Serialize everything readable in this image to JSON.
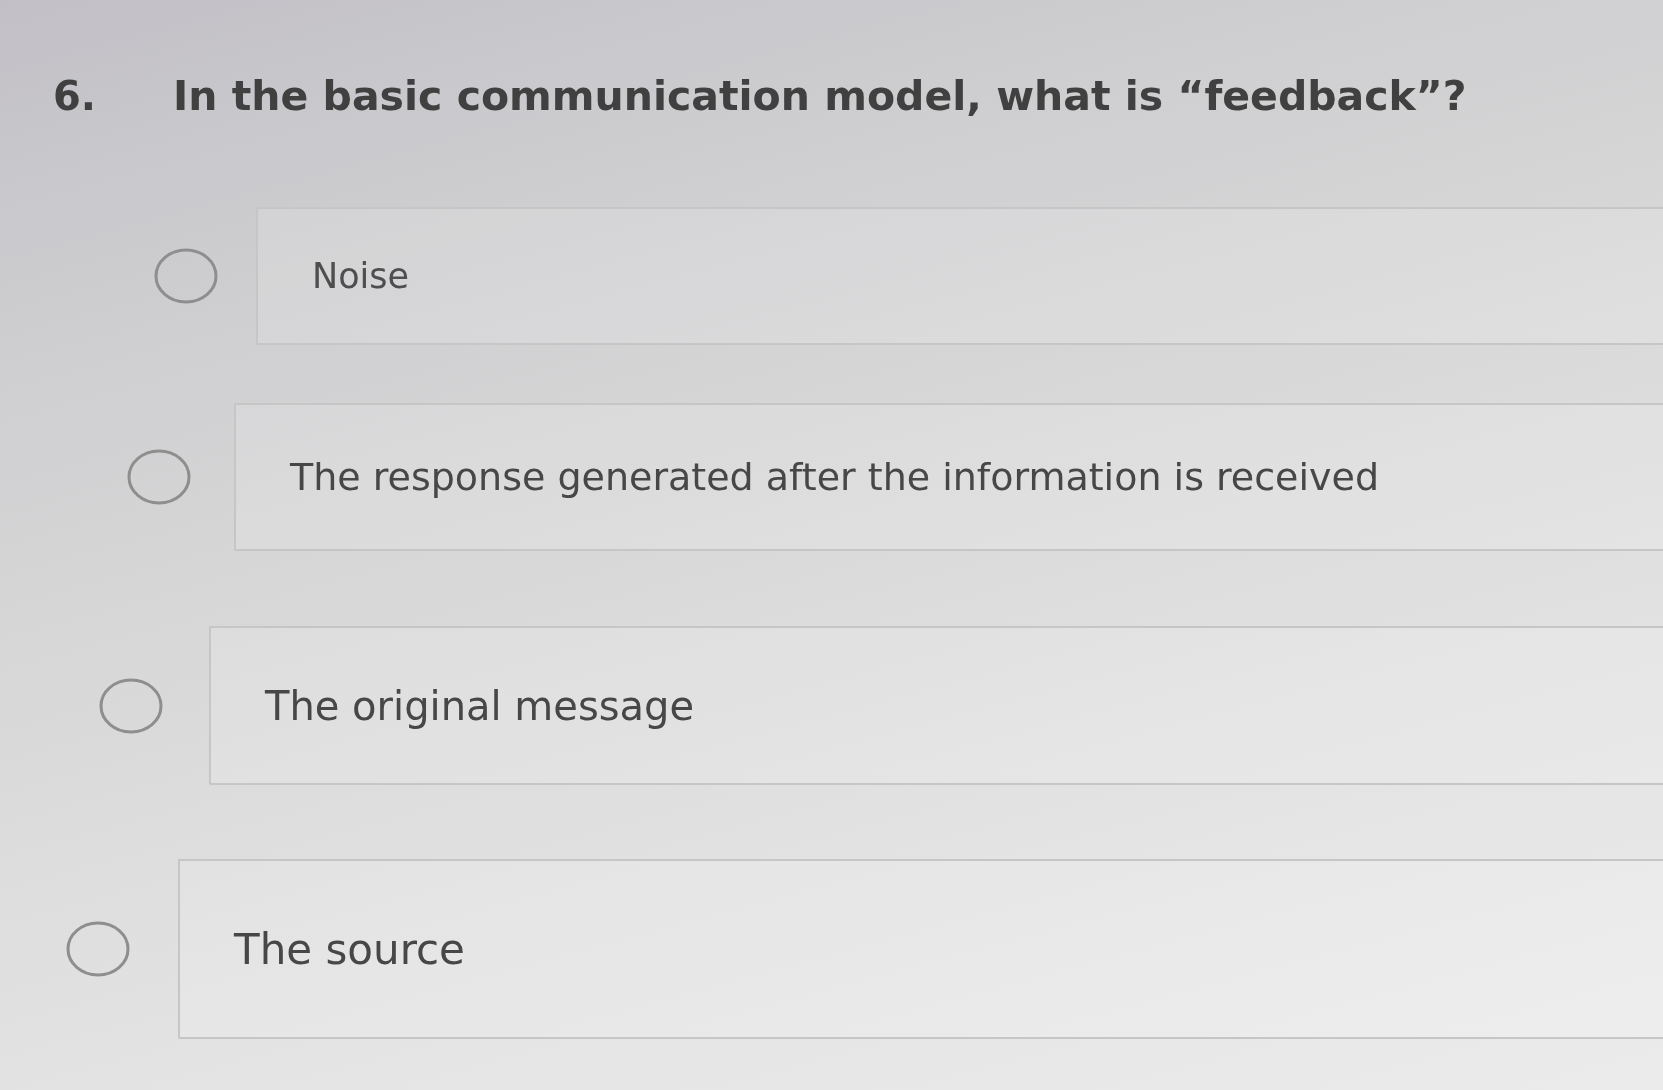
{
  "question": {
    "number": "6.",
    "text": "In the basic communication model, what is “feedback”?"
  },
  "options": [
    {
      "label": "Noise",
      "selected": false
    },
    {
      "label": "The response generated after the information is received",
      "selected": false
    },
    {
      "label": "The original message",
      "selected": false
    },
    {
      "label": "The source",
      "selected": false
    }
  ]
}
